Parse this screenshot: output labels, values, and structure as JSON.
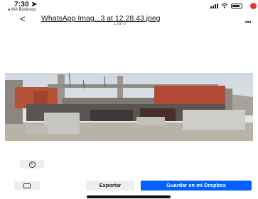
{
  "status_bar": {
    "time": "7:30",
    "back_app": "◂ WA Business",
    "icons": [
      "location-arrow-icon",
      "signal-icon",
      "wifi-icon",
      "battery-icon",
      "notification-dot"
    ]
  },
  "header": {
    "back_symbol": "<",
    "title": "WhatsApp Imag...3 at 12.28.43.jpeg",
    "subtitle": "1 de 3",
    "more_symbol": "..."
  },
  "toolbar": {
    "info_symbol": "i",
    "export_label": "Exportar",
    "save_label": "Guardar en mi Dropbox"
  },
  "colors": {
    "accent": "#0061fe",
    "notification": "#e53935",
    "button_bg": "#eeeeee"
  }
}
